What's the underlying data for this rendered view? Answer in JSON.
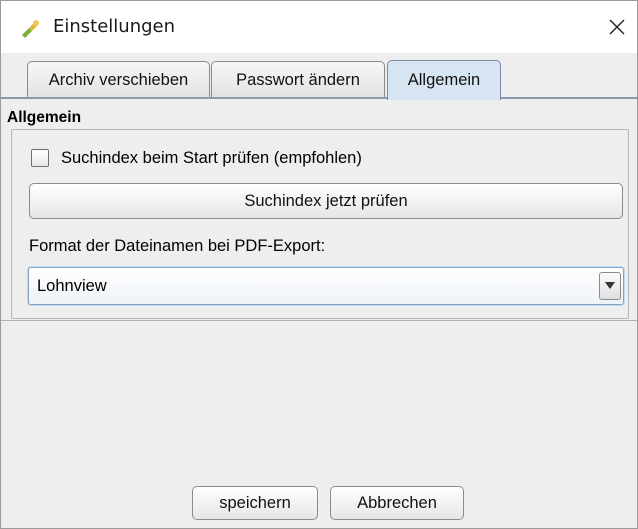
{
  "window": {
    "title": "Einstellungen",
    "icon": "settings-app-icon",
    "close_icon": "close-icon"
  },
  "tabs": [
    {
      "label": "Archiv verschieben",
      "active": false
    },
    {
      "label": "Passwort ändern",
      "active": false
    },
    {
      "label": "Allgemein",
      "active": true
    }
  ],
  "general": {
    "section_title": "Allgemein",
    "check_on_start_label": "Suchindex beim Start prüfen (empfohlen)",
    "check_on_start_checked": false,
    "check_now_label": "Suchindex jetzt prüfen",
    "format_label": "Format der Dateinamen bei PDF-Export:",
    "format_selected": "Lohnview"
  },
  "footer": {
    "save_label": "speichern",
    "cancel_label": "Abbrechen"
  },
  "colors": {
    "active_tab": "#d7e4f2",
    "select_focus": "#7fa2c8",
    "background": "#eeeeee"
  }
}
